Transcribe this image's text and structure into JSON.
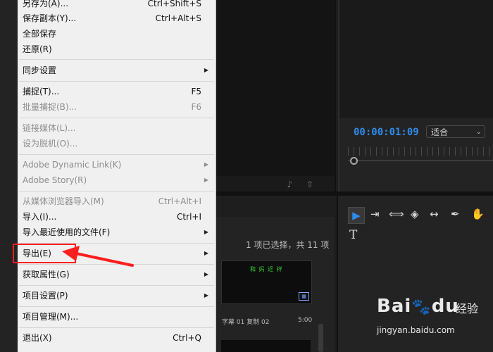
{
  "menu": {
    "items": [
      {
        "label": "另存为(A)...",
        "shortcut": "Ctrl+Shift+S",
        "disabled": false,
        "submenu": false
      },
      {
        "label": "保存副本(Y)...",
        "shortcut": "Ctrl+Alt+S",
        "disabled": false,
        "submenu": false
      },
      {
        "label": "全部保存",
        "shortcut": "",
        "disabled": false,
        "submenu": false
      },
      {
        "label": "还原(R)",
        "shortcut": "",
        "disabled": false,
        "submenu": false
      },
      {
        "label": "同步设置",
        "shortcut": "",
        "disabled": false,
        "submenu": true
      },
      {
        "label": "捕捉(T)...",
        "shortcut": "F5",
        "disabled": false,
        "submenu": false
      },
      {
        "label": "批量捕捉(B)...",
        "shortcut": "F6",
        "disabled": true,
        "submenu": false
      },
      {
        "label": "链接媒体(L)...",
        "shortcut": "",
        "disabled": true,
        "submenu": false
      },
      {
        "label": "设为脱机(O)...",
        "shortcut": "",
        "disabled": true,
        "submenu": false
      },
      {
        "label": "Adobe Dynamic Link(K)",
        "shortcut": "",
        "disabled": true,
        "submenu": true
      },
      {
        "label": "Adobe Story(R)",
        "shortcut": "",
        "disabled": true,
        "submenu": true
      },
      {
        "label": "从媒体浏览器导入(M)",
        "shortcut": "Ctrl+Alt+I",
        "disabled": true,
        "submenu": false
      },
      {
        "label": "导入(I)...",
        "shortcut": "Ctrl+I",
        "disabled": false,
        "submenu": false
      },
      {
        "label": "导入最近使用的文件(F)",
        "shortcut": "",
        "disabled": false,
        "submenu": true
      },
      {
        "label": "导出(E)",
        "shortcut": "",
        "disabled": false,
        "submenu": true
      },
      {
        "label": "获取属性(G)",
        "shortcut": "",
        "disabled": false,
        "submenu": true
      },
      {
        "label": "项目设置(P)",
        "shortcut": "",
        "disabled": false,
        "submenu": true
      },
      {
        "label": "项目管理(M)...",
        "shortcut": "",
        "disabled": false,
        "submenu": false
      },
      {
        "label": "退出(X)",
        "shortcut": "Ctrl+Q",
        "disabled": false,
        "submenu": false
      }
    ],
    "submenu_arrow": "▶"
  },
  "program": {
    "timecode": "00:00:01:09",
    "fit_value": "适合",
    "fit_chevron": "⌄"
  },
  "project": {
    "selection_count": "1 项已选择，共 11 项",
    "clip_label": "字幕 01 复制 02",
    "clip_duration": "5:00",
    "thumb_text": "和 妈 近 祥",
    "thumb_badge": "▦"
  },
  "tools": [
    {
      "name": "selection-tool-icon",
      "glyph": "▶"
    },
    {
      "name": "track-select-tool-icon",
      "glyph": "⇥"
    },
    {
      "name": "ripple-edit-tool-icon",
      "glyph": "⟺"
    },
    {
      "name": "razor-tool-icon",
      "glyph": "◈"
    },
    {
      "name": "slip-tool-icon",
      "glyph": "↔"
    },
    {
      "name": "pen-tool-icon",
      "glyph": "✒"
    },
    {
      "name": "hand-tool-icon",
      "glyph": "✋"
    },
    {
      "name": "type-tool-icon",
      "glyph": "T"
    }
  ],
  "source_panel": {
    "icons": "♪ ⇧"
  },
  "watermark": {
    "brand": "Bai",
    "brand2": "du",
    "paw": "🐾",
    "jingyan": "经验",
    "url": "jingyan.baidu.com"
  },
  "colors": {
    "timecode": "#2d8ceb",
    "highlight": "#ff1e1e",
    "menu_bg": "#f0f0f0"
  }
}
